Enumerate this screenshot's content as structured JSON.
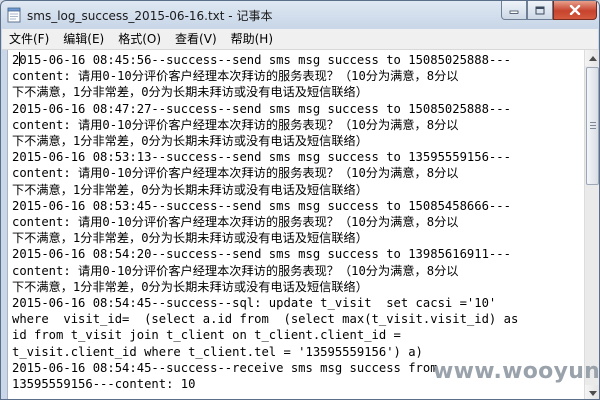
{
  "window": {
    "title": "sms_log_success_2015-06-16.txt - 记事本",
    "icon": "notepad-icon"
  },
  "menu": {
    "items": [
      {
        "id": "file",
        "label": "文件(F)"
      },
      {
        "id": "edit",
        "label": "编辑(E)"
      },
      {
        "id": "format",
        "label": "格式(O)"
      },
      {
        "id": "view",
        "label": "查看(V)"
      },
      {
        "id": "help",
        "label": "帮助(H)"
      }
    ]
  },
  "document": {
    "first_char": "2",
    "first_line_rest": "015-06-16 08:45:56--success--send sms msg success to 15085025888---",
    "lines": [
      "content: 请用0-10分评价客户经理本次拜访的服务表现？（10分为满意，8分以",
      "下不满意，1分非常差，0分为长期未拜访或没有电话及短信联络）",
      "2015-06-16 08:47:27--success--send sms msg success to 15085025888---",
      "content: 请用0-10分评价客户经理本次拜访的服务表现？（10分为满意，8分以",
      "下不满意，1分非常差，0分为长期未拜访或没有电话及短信联络）",
      "2015-06-16 08:53:13--success--send sms msg success to 13595559156---",
      "content: 请用0-10分评价客户经理本次拜访的服务表现？（10分为满意，8分以",
      "下不满意，1分非常差，0分为长期未拜访或没有电话及短信联络）",
      "2015-06-16 08:53:45--success--send sms msg success to 15085458666---",
      "content: 请用0-10分评价客户经理本次拜访的服务表现？（10分为满意，8分以",
      "下不满意，1分非常差，0分为长期未拜访或没有电话及短信联络）",
      "2015-06-16 08:54:20--success--send sms msg success to 13985616911---",
      "content: 请用0-10分评价客户经理本次拜访的服务表现？（10分为满意，8分以",
      "下不满意，1分非常差，0分为长期未拜访或没有电话及短信联络）",
      "2015-06-16 08:54:45--success--sql: update t_visit  set cacsi ='10'",
      "where  visit_id=  (select a.id from  (select max(t_visit.visit_id) as",
      "id from t_visit join t_client on t_client.client_id =",
      "t_visit.client_id where t_client.tel = '13595559156') a)",
      "2015-06-16 08:54:45--success--receive sms msg success from",
      "13595559156---content: 10"
    ]
  },
  "watermark": "www.wooyun.org",
  "colors": {
    "titlebar": "#c9d7e8",
    "close_button": "#c7432d",
    "menubar": "#f0f0f0",
    "editor_bg": "#ffffff"
  }
}
